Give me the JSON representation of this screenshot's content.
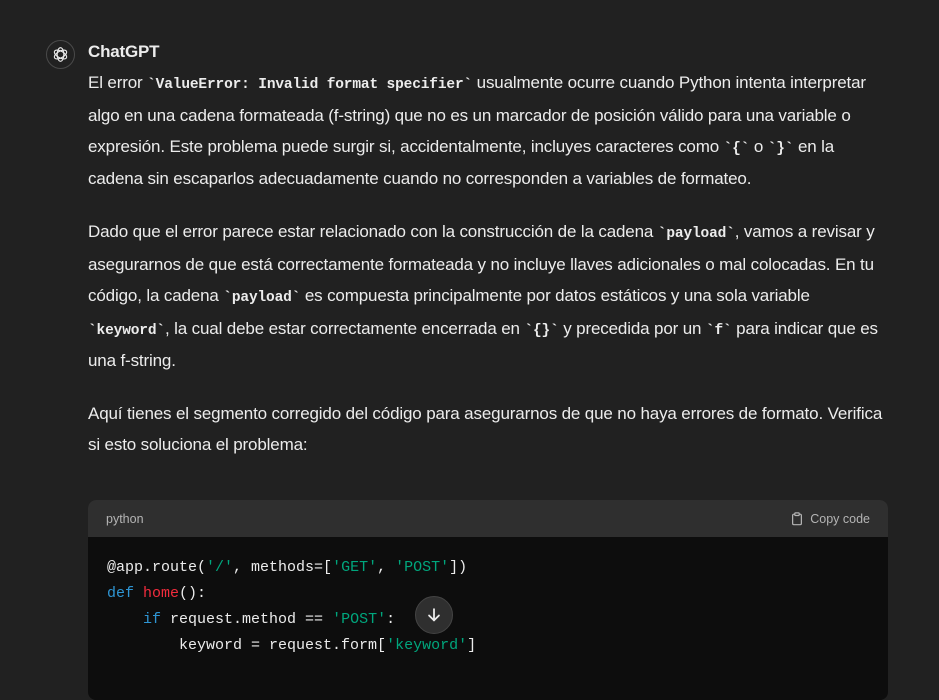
{
  "message": {
    "sender": "ChatGPT",
    "avatar_icon": "openai-logo-icon",
    "paragraphs": [
      {
        "t1": "El error ",
        "c1": "`ValueError: Invalid format specifier`",
        "t2": " usualmente ocurre cuando Python intenta interpretar algo en una cadena formateada (f-string) que no es un marcador de posición válido para una variable o expresión. Este problema puede surgir si, accidentalmente, incluyes caracteres como ",
        "c2": "`{`",
        "t3": " o ",
        "c3": "`}`",
        "t4": " en la cadena sin escaparlos adecuadamente cuando no corresponden a variables de formateo."
      },
      {
        "t1": "Dado que el error parece estar relacionado con la construcción de la cadena ",
        "c1": "`payload`",
        "t2": ", vamos a revisar y asegurarnos de que está correctamente formateada y no incluye llaves adicionales o mal colocadas. En tu código, la cadena ",
        "c2": "`payload`",
        "t3": " es compuesta principalmente por datos estáticos y una sola variable ",
        "c3": "`keyword`",
        "t4": ", la cual debe estar correctamente encerrada en ",
        "c4": "`{}`",
        "t5": " y precedida por un ",
        "c5": "`f`",
        "t6": " para indicar que es una f-string."
      },
      {
        "t1": "Aquí tienes el segmento corregido del código para asegurarnos de que no haya errores de formato. Verifica si esto soluciona el problema:"
      }
    ],
    "code_block": {
      "language": "python",
      "copy_label": "Copy code",
      "copy_icon": "clipboard-icon",
      "lines": [
        {
          "a": "@app.route(",
          "b": "'/'",
          "c": ", methods=[",
          "d": "'GET'",
          "e": ", ",
          "f": "'POST'",
          "g": "])"
        },
        {
          "kw": "def",
          "fn": "home",
          "rest": "():"
        },
        {
          "indent": "    ",
          "kw": "if",
          "rest": " request.method == ",
          "st": "'POST'",
          "end": ":"
        },
        {
          "indent": "        ",
          "rest": "keyword = request.form[",
          "st": "'keyword'",
          "end": "]"
        }
      ]
    }
  },
  "scroll_button": {
    "icon": "arrow-down-icon"
  },
  "colors": {
    "background": "#212121",
    "code_bg": "#0d0d0d",
    "code_header_bg": "#2f2f2f",
    "keyword": "#2e95d3",
    "function": "#f22c3d",
    "string": "#00a67d"
  }
}
